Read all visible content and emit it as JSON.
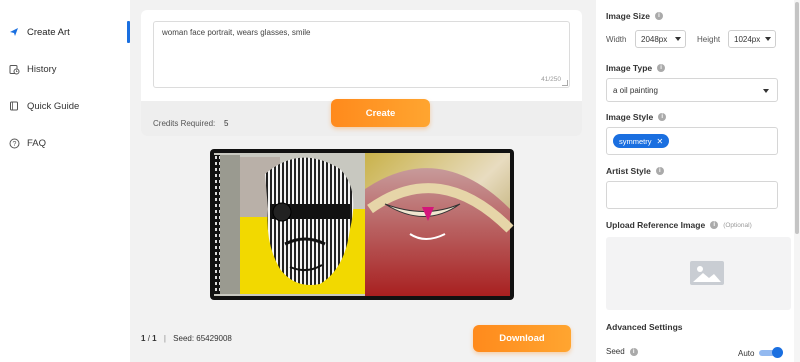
{
  "sidebar": {
    "items": [
      {
        "label": "Create Art",
        "icon": "paper-plane-icon",
        "active": true
      },
      {
        "label": "History",
        "icon": "history-icon",
        "active": false
      },
      {
        "label": "Quick Guide",
        "icon": "book-icon",
        "active": false
      },
      {
        "label": "FAQ",
        "icon": "help-circle-icon",
        "active": false
      }
    ]
  },
  "prompt": {
    "text": "woman face portrait, wears glasses, smile",
    "counter": "41/250",
    "credits_label": "Credits Required:",
    "credits_value": "5",
    "create_label": "Create"
  },
  "result": {
    "page_current": "1",
    "page_sep": "/",
    "page_total": "1",
    "seed_text": "Seed: 65429008",
    "download_label": "Download"
  },
  "panel": {
    "image_size_title": "Image Size",
    "width_label": "Width",
    "width_value": "2048px",
    "height_label": "Height",
    "height_value": "1024px",
    "image_type_title": "Image Type",
    "image_type_value": "a oil painting",
    "image_style_title": "Image Style",
    "style_chip": "symmetry",
    "artist_style_title": "Artist Style",
    "artist_style_value": "",
    "upload_title": "Upload Reference Image",
    "upload_optional": "(Optional)",
    "advanced_title": "Advanced Settings",
    "seed_label": "Seed",
    "auto_label": "Auto",
    "auto_enabled": true
  },
  "colors": {
    "accent_blue": "#1a6fe0",
    "button_orange": "#ff9a26"
  }
}
